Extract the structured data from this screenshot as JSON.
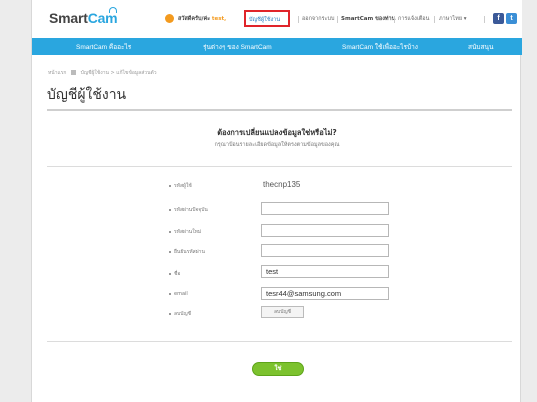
{
  "header": {
    "logo_smart": "Smart",
    "logo_cam": "Cam",
    "greeting": "สวัสดีครับ/ค่ะ",
    "username": "test,",
    "account_link": "บัญชีผู้ใช้งาน",
    "logout": "ออกจากระบบ",
    "my_smartcam": "SmartCam ของท่าน",
    "settings": "การแจ้งเตือน",
    "language": "ภาษาไทย",
    "social": [
      "f",
      "t"
    ]
  },
  "menu": [
    {
      "label": "SmartCam คืออะไร"
    },
    {
      "label": "รุ่นต่างๆ ของ SmartCam"
    },
    {
      "label": "SmartCam ใช้เพื่ออะไรบ้าง"
    },
    {
      "label": "สนับสนุน"
    }
  ],
  "breadcrumb": {
    "home": "หน้าแรก",
    "path": "บัญชีผู้ใช้งาน > แก้ไขข้อมูลส่วนตัว"
  },
  "page_title": "บัญชีผู้ใช้งาน",
  "question": "ต้องการเปลี่ยนแปลงข้อมูลใช่หรือไม่?",
  "subtitle": "กรุณาป้อนรายละเอียดข้อมูลให้ตรงตามข้อมูลของคุณ",
  "form": {
    "user_id_label": "รหัสผู้ใช้",
    "user_id_value": "thecnp135",
    "current_password_label": "รหัสผ่านปัจจุบัน",
    "current_password_value": "",
    "new_password_label": "รหัสผ่านใหม่",
    "new_password_value": "",
    "confirm_password_label": "ยืนยันรหัสผ่าน",
    "confirm_password_value": "",
    "name_label": "ชื่อ",
    "name_value": "test",
    "email_label": "email",
    "email_value": "tesr44@samsung.com",
    "delete_label": "ลบบัญชี",
    "delete_button": "ลบบัญชี"
  },
  "submit_button": "ใช่",
  "colors": {
    "accent_blue": "#2aa6df",
    "highlight_red": "#e0242a",
    "submit_green": "#7cc22e",
    "user_orange": "#f39a1e"
  }
}
